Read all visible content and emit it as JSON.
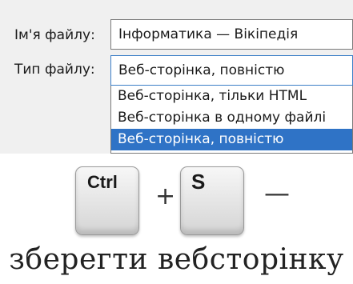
{
  "save_dialog": {
    "filename_label": "Ім'я файлу:",
    "filename_value": "Інформатика — Вікіпедія",
    "filetype_label": "Тип файлу:",
    "filetype_value": "Веб-сторінка, повністю",
    "filetype_options": [
      "Веб-сторінка, тільки HTML",
      "Веб-сторінка в одному файлі",
      "Веб-сторінка, повністю"
    ],
    "selected_option": "Веб-сторінка, повністю",
    "selection_color": "#2f73c6"
  },
  "shortcut": {
    "key1": "Ctrl",
    "plus": "+",
    "key2": "S",
    "dash": "—"
  },
  "caption": "зберегти вебсторінку"
}
